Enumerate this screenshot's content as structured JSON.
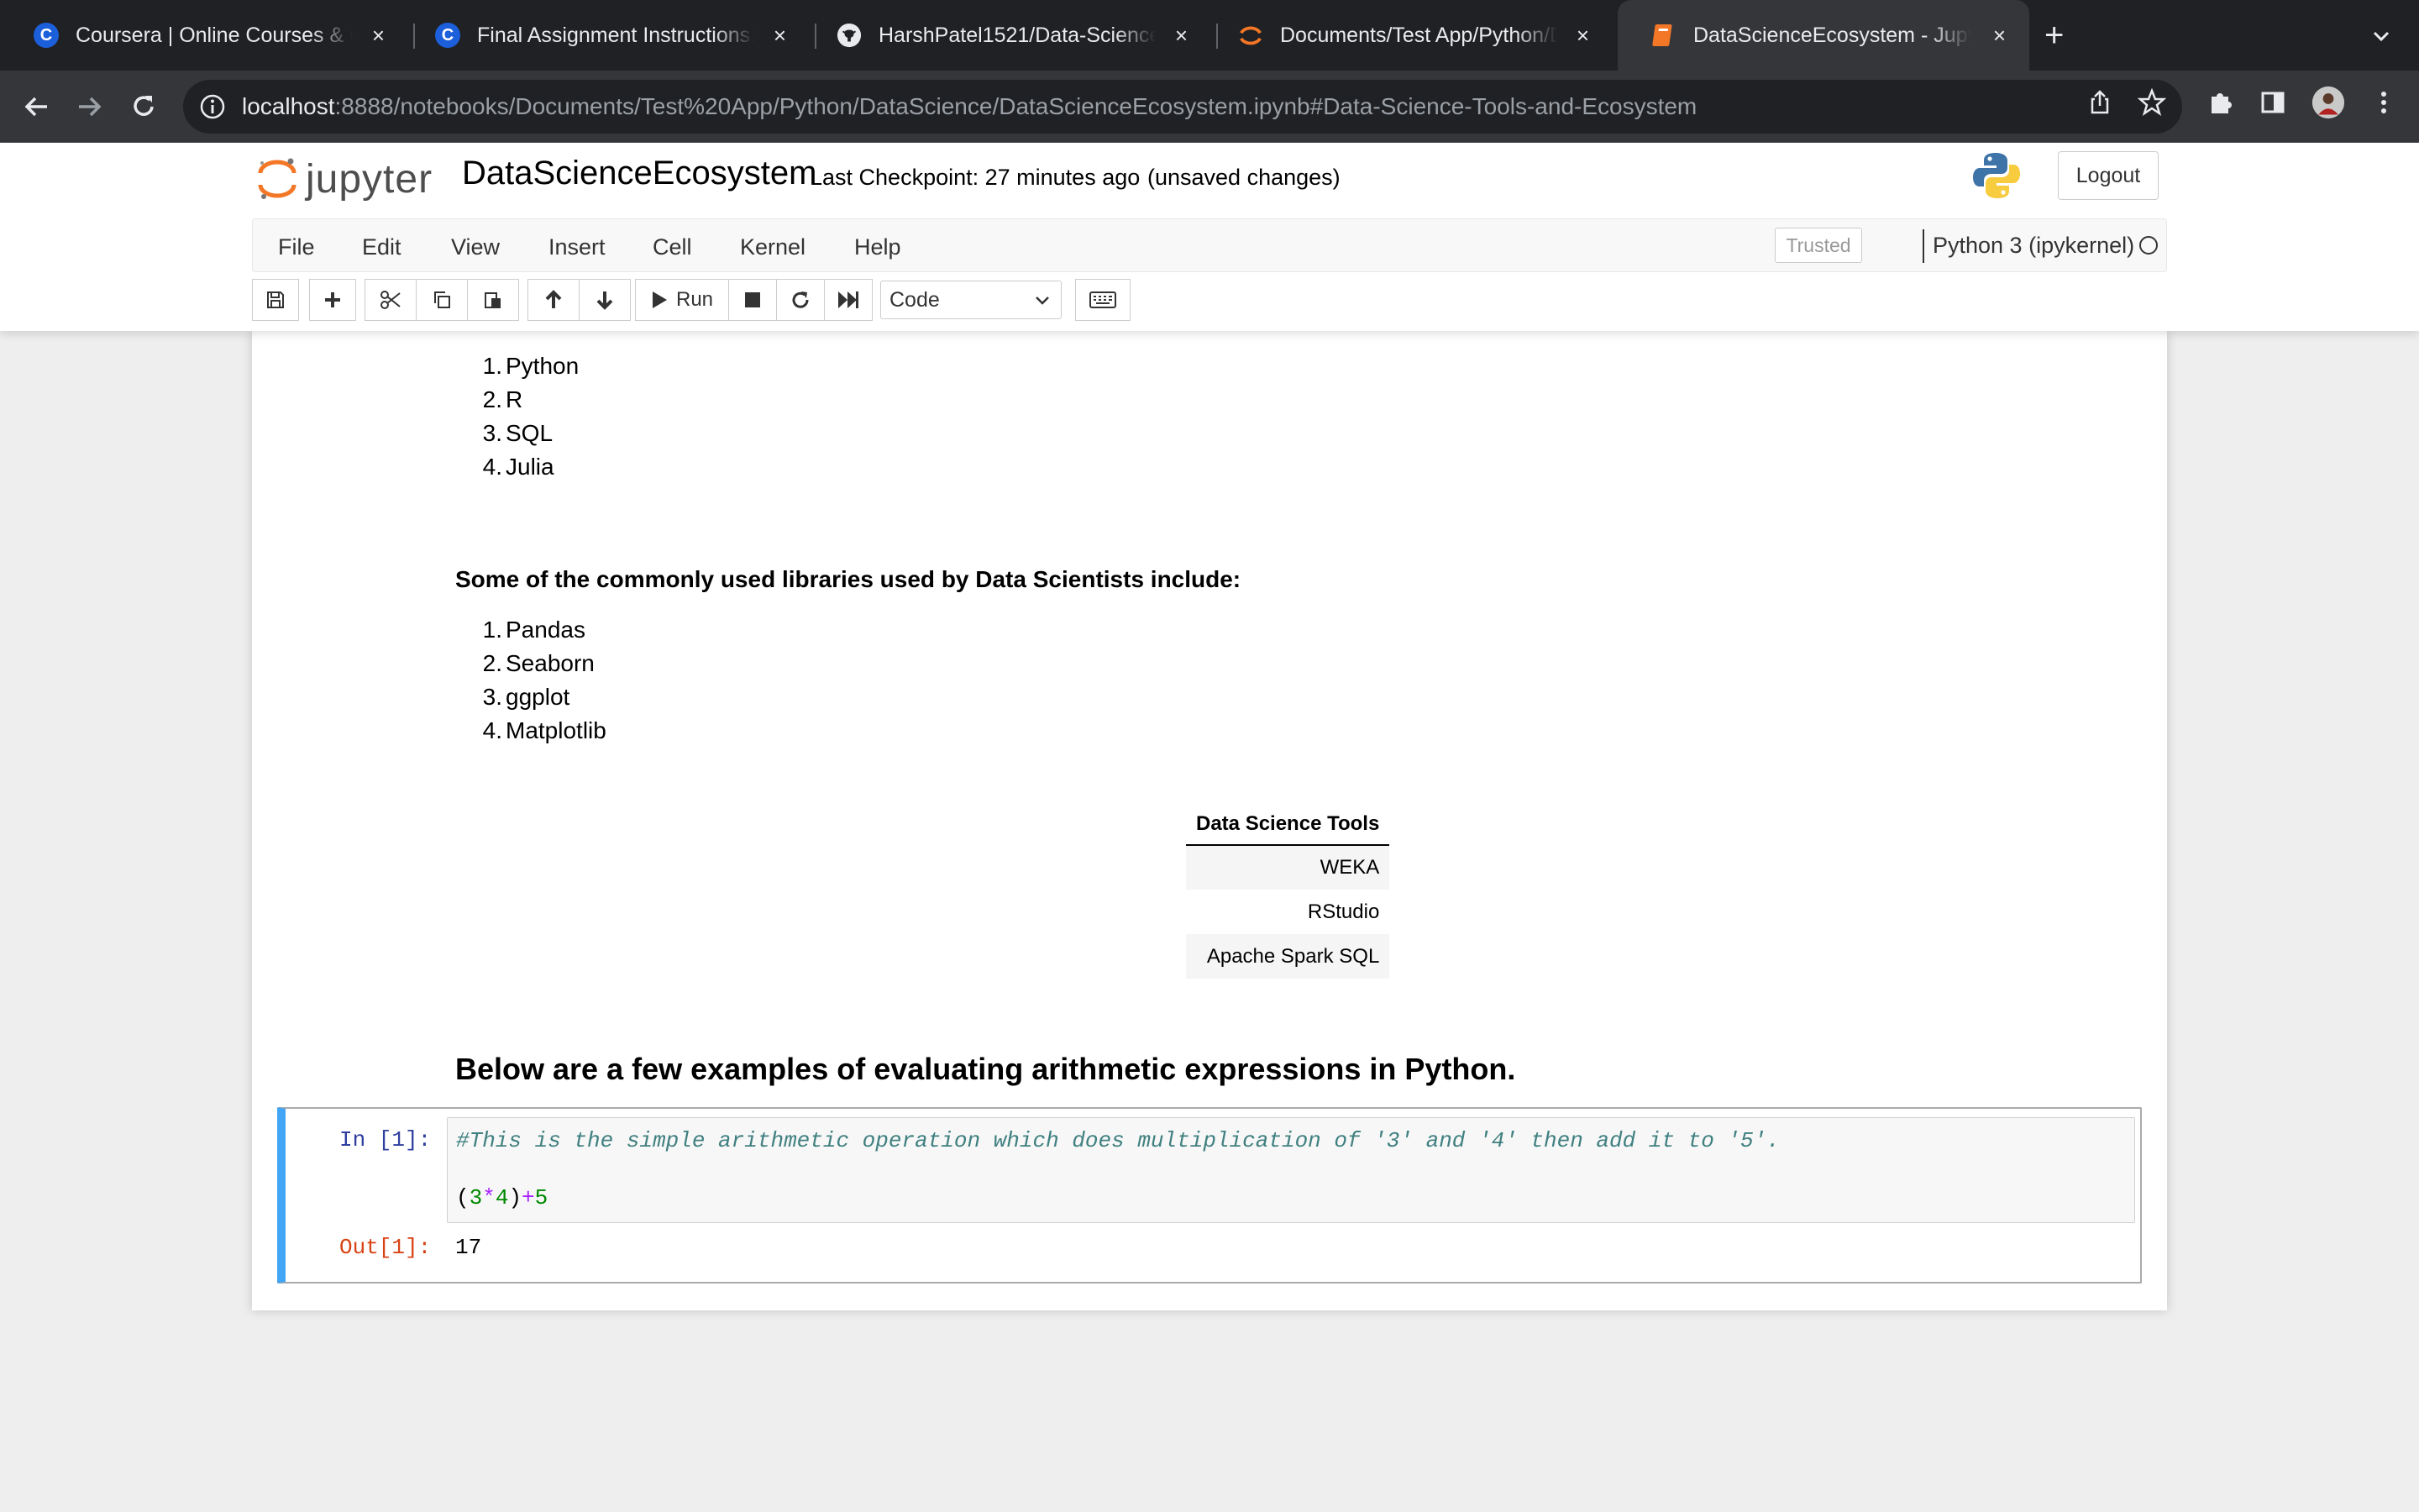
{
  "browser": {
    "tabs": [
      {
        "title": "Coursera | Online Courses & C",
        "icon": "coursera-icon"
      },
      {
        "title": "Final Assignment Instructions:",
        "icon": "coursera-icon"
      },
      {
        "title": "HarshPatel1521/Data-Science",
        "icon": "github-icon"
      },
      {
        "title": "Documents/Test App/Python/D",
        "icon": "jupyter-icon"
      },
      {
        "title": "DataScienceEcosystem - Jupy",
        "icon": "notebook-icon"
      }
    ],
    "url_host": "localhost",
    "url_rest": ":8888/notebooks/Documents/Test%20App/Python/DataScience/DataScienceEcosystem.ipynb#Data-Science-Tools-and-Ecosystem"
  },
  "header": {
    "logo_text": "jupyter",
    "notebook_name": "DataScienceEcosystem",
    "checkpoint": "Last Checkpoint: 27 minutes ago",
    "unsaved": "(unsaved changes)",
    "logout": "Logout"
  },
  "menu": {
    "items": [
      "File",
      "Edit",
      "View",
      "Insert",
      "Cell",
      "Kernel",
      "Help"
    ],
    "trusted": "Trusted",
    "kernel": "Python 3 (ipykernel)"
  },
  "toolbar": {
    "run_label": "Run",
    "cell_type": "Code"
  },
  "content": {
    "languages": [
      "Python",
      "R",
      "SQL",
      "Julia"
    ],
    "libraries_heading": "Some of the commonly used libraries used by Data Scientists include:",
    "libraries": [
      "Pandas",
      "Seaborn",
      "ggplot",
      "Matplotlib"
    ],
    "tools_table": {
      "header": "Data Science Tools",
      "rows": [
        "WEKA",
        "RStudio",
        "Apache Spark SQL"
      ]
    },
    "arith_heading": "Below are a few examples of evaluating arithmetic expressions in Python.",
    "cell": {
      "in_prompt": "In [1]:",
      "comment": "#This is the simple arithmetic operation which does multiplication of '3' and '4' then add it to '5'.",
      "code_parts": [
        "(",
        "3",
        "*",
        "4",
        ")",
        "+",
        "5"
      ],
      "out_prompt": "Out[1]:",
      "output": "17"
    }
  }
}
